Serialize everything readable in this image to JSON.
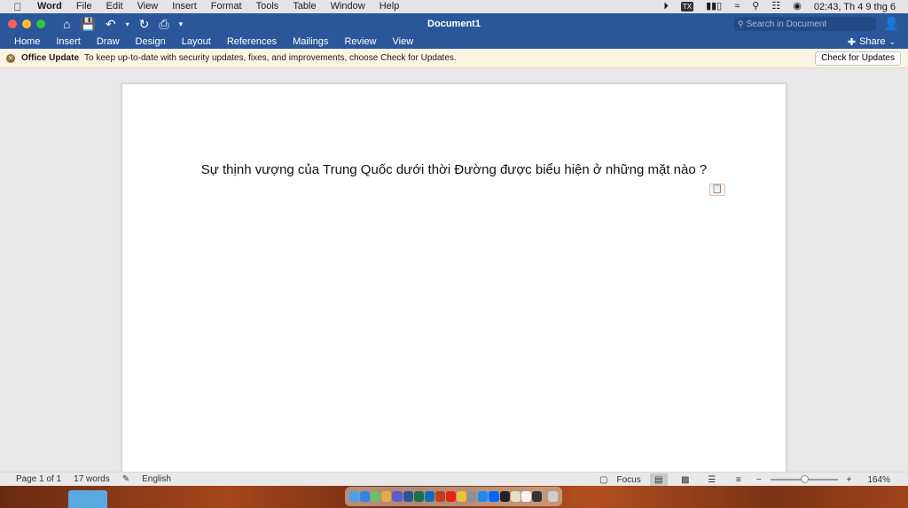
{
  "menubar": {
    "app_name": "Word",
    "items": [
      "File",
      "Edit",
      "View",
      "Insert",
      "Format",
      "Tools",
      "Table",
      "Window",
      "Help"
    ],
    "status_icons": [
      "play-icon",
      "input-source-icon",
      "battery-icon",
      "wifi-icon",
      "search-icon",
      "control-center-icon",
      "siri-icon"
    ],
    "clock": "02:43, Th 4 9 thg 6"
  },
  "titlebar": {
    "document_title": "Document1",
    "search_placeholder": "Search in Document"
  },
  "ribbon": {
    "tabs": [
      "Home",
      "Insert",
      "Draw",
      "Design",
      "Layout",
      "References",
      "Mailings",
      "Review",
      "View"
    ],
    "share_label": "Share"
  },
  "update_bar": {
    "title": "Office Update",
    "message": "To keep up-to-date with security updates, fixes, and improvements, choose Check for Updates.",
    "button": "Check for Updates"
  },
  "document": {
    "text": "Sự thịnh vượng của Trung Quốc dưới thời Đường được biểu hiện ở những mặt nào ?"
  },
  "statusbar": {
    "page": "Page 1 of 1",
    "words": "17 words",
    "language": "English",
    "focus": "Focus",
    "zoom": "164%",
    "zoom_fraction": 0.5
  },
  "colors": {
    "word_blue": "#2b579a",
    "update_bar_bg": "#fbf4e2",
    "page_bg": "#ffffff"
  }
}
